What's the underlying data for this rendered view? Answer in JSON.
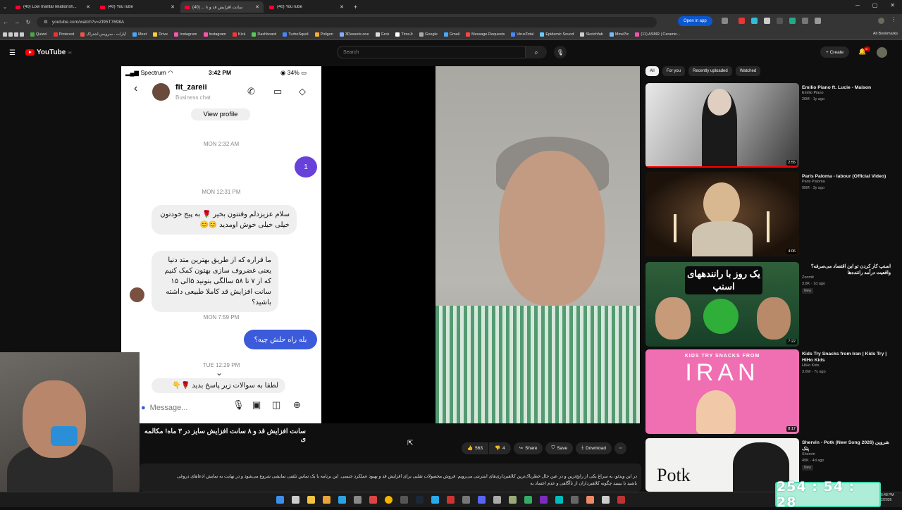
{
  "browser": {
    "tabs": [
      {
        "title": "(40) Low marital relationsh...",
        "active": false
      },
      {
        "title": "(40) YouTube",
        "active": false
      },
      {
        "title": "سانت افزایش قد و ۸ ... (40)",
        "active": true
      },
      {
        "title": "(40) YouTube",
        "active": false
      }
    ],
    "new_tab": "+",
    "url": "youtube.com/watch?v=ZI95T7698A",
    "open_in_app": "Open in app",
    "bookmarks": [
      "Quizel",
      "Pinterest",
      "آپارات - سرویس اشتراک",
      "Meet",
      "Drive",
      "Instagram",
      "Instagram",
      "Kick",
      "Dashboard",
      "TurboSquid",
      "Poligon",
      "3Dassets.one",
      "Grok",
      "TimeJr",
      "Google",
      "Gmail",
      "Message Requests",
      "VirusTotal",
      "Epidemic Sound",
      "Sketchfab",
      "MinePic",
      "(11) ASMR | Ceramic..."
    ],
    "all_bookmarks": "All Bookmarks"
  },
  "youtube": {
    "logo_text": "YouTube",
    "region": "DE",
    "search_placeholder": "Search",
    "create_label": "Create",
    "notif_count": "9+"
  },
  "phone": {
    "carrier": "Spectrum",
    "time": "3:42 PM",
    "battery": "34%",
    "contact_name": "fit_zareii",
    "contact_sub": "Business chat",
    "view_profile": "View profile",
    "ts1": "MON 2:32 AM",
    "sent1": "1",
    "ts2": "MON 12:31 PM",
    "msg1": "سلام عزیزدلم وقتتون بخیر 🌹 به پیج خودتون خیلی خیلی خوش اومدید 😊😊",
    "msg2": "ما قراره که از طریق بهترین متد دنیا یعنی غضروف سازی بهتون کمک کنیم که از ۷ تا ۵۸ سالگی بتونید ۵الی ۱۵ سانت افزایش قد کاملا طبیعی داشته باشید؟",
    "ts3": "MON 7:59 PM",
    "sent2": "بله راه حلش چیه؟",
    "ts4": "TUE 12:29 PM",
    "msg3": "لطفا به سوالات زیر پاسخ بدید 🌹👇",
    "message_placeholder": "Message..."
  },
  "video": {
    "title": "سانت افزایش قد و ۸ سانت افزایش سایز در ۳ ماه! مکالمه ی",
    "likes": "563",
    "dislikes": "4",
    "share": "Share",
    "save": "Save",
    "download": "Download",
    "more": "⋯",
    "description_line1": "در این ویدئو، به سراغ یکی از رایج‌ترین و در عین حال خطرناک‌ترین کلاهبرداری‌های اینترنتی می‌رویم: فروش محصولات تقلبی برای افزایش قد و بهبود عملکرد جنسی. این برنامه با یک تماس تلفنی نمایشی شروع می‌شود و در نهایت به نمایش ادعاهای دروغی",
    "description_line2": "باشید تا ببینید چگونه کلاهبرداران از ناآگاهی و عدم اعتماد به"
  },
  "sidebar": {
    "chips": [
      {
        "label": "All",
        "active": true
      },
      {
        "label": "For you",
        "active": false
      },
      {
        "label": "Recently uploaded",
        "active": false
      },
      {
        "label": "Watched",
        "active": false
      }
    ],
    "cards": [
      {
        "title": "Emilio Piano ft. Lucie - Maison",
        "channel": "Emilio Piano",
        "meta": "20M · 1y ago",
        "duration": "2:55",
        "new": false,
        "rtl": false
      },
      {
        "title": "Paris Paloma - labour (Official Video)",
        "channel": "Paris Paloma",
        "meta": "95M · 3y ago",
        "duration": "4:06",
        "new": false,
        "rtl": false
      },
      {
        "title": "اسنپ کار کردن تو این اقتصاد می‌صرفه؟ واقعیت درآمد راننده‌ها",
        "channel": "Zoomit",
        "meta": "3.8K · 1d ago",
        "duration": "7:22",
        "new": true,
        "new_label": "New",
        "rtl": true,
        "thumb_text": "یک روز با رانندههای اسنپ"
      },
      {
        "title": "Kids Try Snacks from Iran | Kids Try | HiHo Kids",
        "channel": "HiHo Kids",
        "meta": "3.6M · 7y ago",
        "duration": "8:17",
        "new": false,
        "rtl": false,
        "thumb_top": "KIDS TRY SNACKS FROM",
        "thumb_big": "IRAN"
      },
      {
        "title": "Shervin - Potk (New Song 2026) شروین پتک",
        "channel": "Shervin",
        "meta": "49K · 4d ago",
        "duration": "",
        "new": true,
        "new_label": "New",
        "rtl": false,
        "thumb_text": "Potk"
      }
    ]
  },
  "overlay": {
    "timer": "254 : 54 : 28",
    "clock_time": "6:48 PM",
    "clock_date": "2/2026"
  },
  "colors": {
    "yt_red": "#ff0000",
    "ig_blue": "#3b5bdb",
    "timer_bg": "#aeeed8",
    "open_app": "#0b57d0"
  }
}
